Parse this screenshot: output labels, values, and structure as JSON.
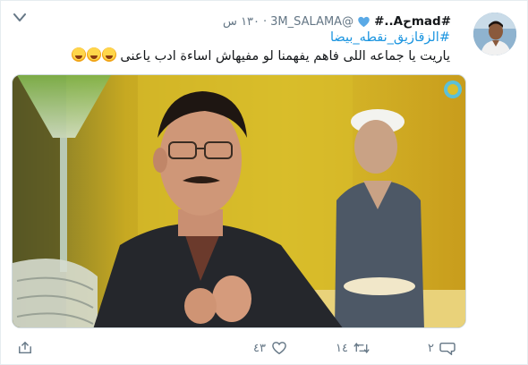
{
  "tweet": {
    "author_name": "#madحA..#",
    "handle": "@3M_SALAMA",
    "separator": "·",
    "time": "١٣٠ س",
    "hashtag": "#الزقازيق_نقطه_بيضا",
    "text": "ياريت يا جماعه اللى فاهم يفهمنا لو مفيهاش اساءة ادب ياعنى",
    "actions": {
      "reply_count": "٢",
      "retweet_count": "١٤",
      "like_count": "٤٣"
    }
  },
  "colors": {
    "link": "#1b95e0",
    "muted": "#657786",
    "verified": "#1da1f2"
  },
  "icons": [
    "caret-down-icon",
    "verified-badge-icon",
    "reply-icon",
    "retweet-icon",
    "like-icon",
    "share-icon"
  ]
}
